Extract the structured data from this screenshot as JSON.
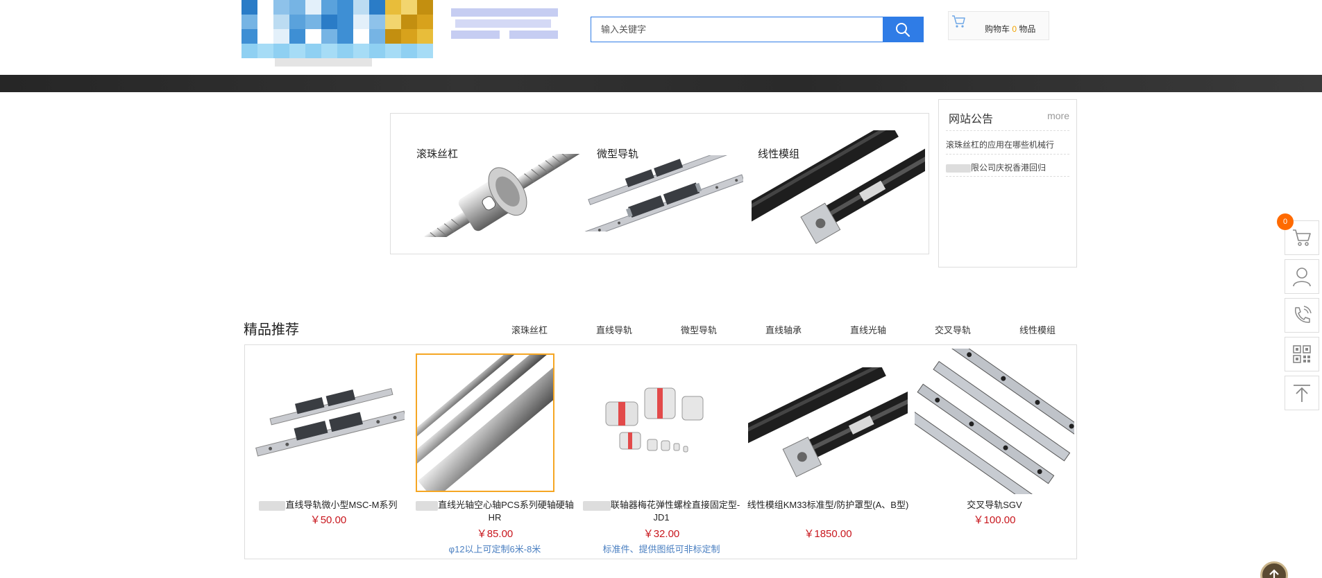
{
  "header": {
    "search_placeholder": "输入关键字",
    "cart_prefix": "购物车 ",
    "cart_count": "0",
    "cart_suffix": " 物品"
  },
  "banner": {
    "categories": [
      "滚珠丝杠",
      "微型导轨",
      "线性模组"
    ]
  },
  "notice": {
    "title": "网站公告",
    "more": "more",
    "items": [
      "滚珠丝杠的应用在哪些机械行",
      "限公司庆祝香港回归"
    ]
  },
  "recommend": {
    "title": "精品推荐",
    "tabs": [
      "滚珠丝杠",
      "直线导轨",
      "微型导轨",
      "直线轴承",
      "直线光轴",
      "交叉导轨",
      "线性模组"
    ],
    "products": [
      {
        "name": "直线导轨微小型MSC-M系列",
        "price": "￥50.00",
        "note": ""
      },
      {
        "name": "直线光轴空心轴PCS系列硬轴硬轴HR",
        "price": "￥85.00",
        "note": "φ12以上可定制6米-8米"
      },
      {
        "name": "联轴器梅花弹性螺栓直接固定型-JD1",
        "price": "￥32.00",
        "note": "标准件、提供图纸可非标定制"
      },
      {
        "name": "线性模组KM33标准型/防护罩型(A、B型)",
        "price": "￥1850.00",
        "note": ""
      },
      {
        "name": "交叉导轨SGV",
        "price": "￥100.00",
        "note": ""
      }
    ]
  },
  "float_bar": {
    "cart_badge": "0",
    "icons": [
      "cart-icon",
      "user-icon",
      "phone-icon",
      "qrcode-icon",
      "back-to-top-icon"
    ]
  },
  "colors": {
    "accent": "#2f7ce6",
    "price": "#c8161d",
    "badge": "#ff6a00",
    "cart_count": "#f2a300"
  }
}
